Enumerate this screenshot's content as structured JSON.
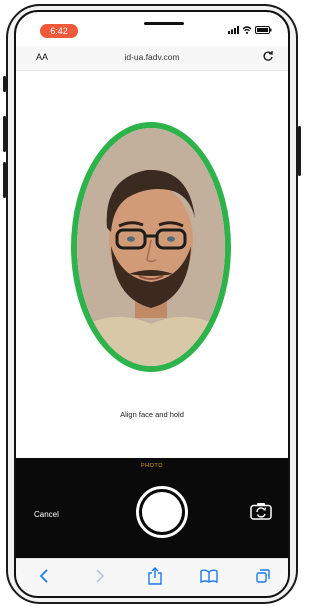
{
  "status_bar": {
    "time": "6:42"
  },
  "browser": {
    "text_size_label": "AA",
    "url": "id-ua.fadv.com"
  },
  "capture": {
    "instruction": "Align face and hold"
  },
  "camera": {
    "mode": "PHOTO",
    "cancel_label": "Cancel"
  },
  "colors": {
    "oval": "#2db34a",
    "time_pill": "#f05a3b",
    "mode_label": "#e0a400",
    "toolbar_icons": "#1a7cf0"
  },
  "icons": [
    "signal-icon",
    "wifi-icon",
    "battery-icon",
    "reload-icon",
    "switch-camera-icon",
    "back-icon",
    "forward-icon",
    "share-icon",
    "bookmarks-icon",
    "tabs-icon"
  ]
}
